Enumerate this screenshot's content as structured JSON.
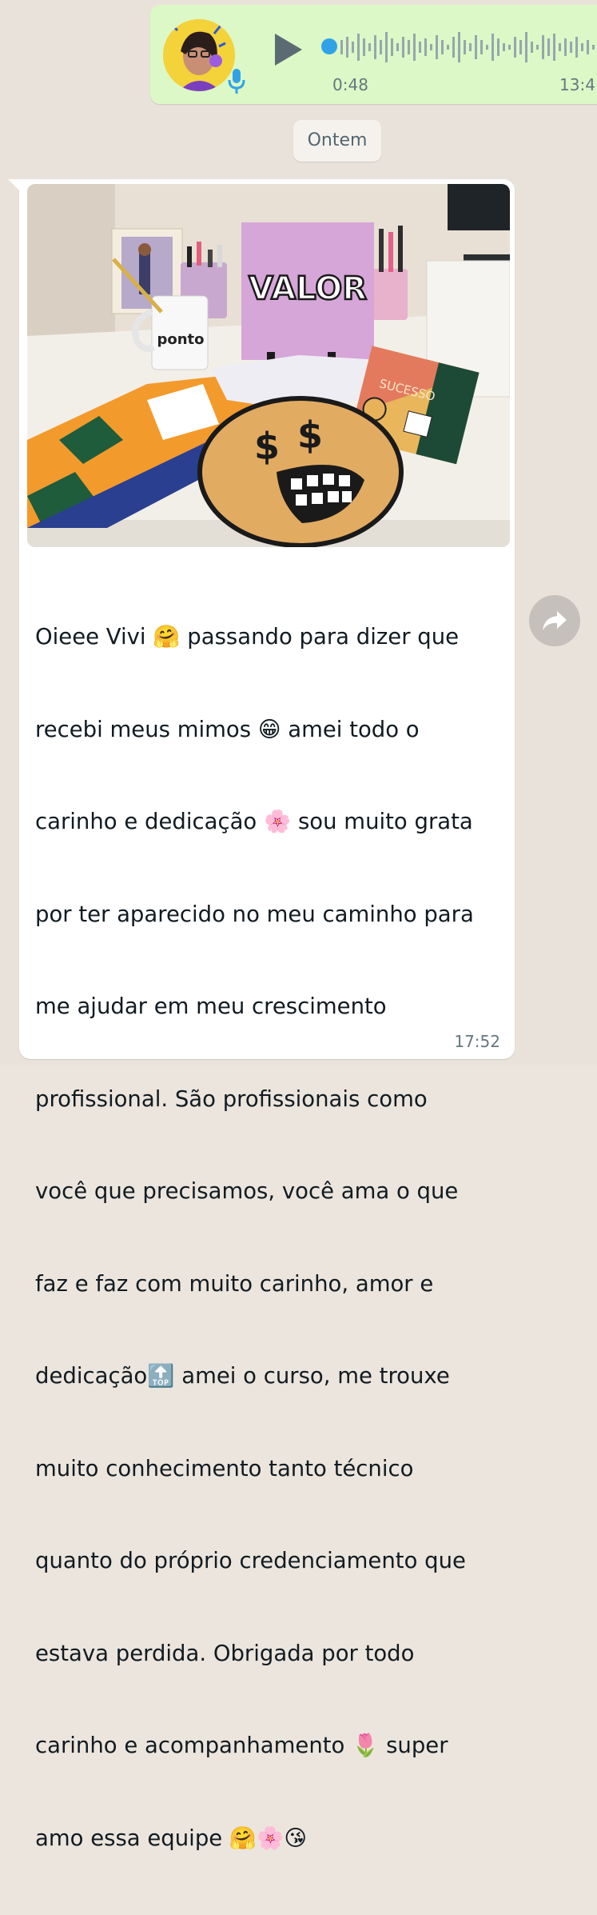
{
  "voice_note": {
    "duration": "0:48",
    "time": "13:4"
  },
  "date_separator": "Ontem",
  "message": {
    "photo_texts": {
      "poster": "VALOR",
      "mug": "ponto",
      "book": "SUCESSO"
    },
    "lines": [
      "Oieee Vivi 🤗 passando para dizer que",
      "recebi meus mimos 😁 amei todo o",
      "carinho e dedicação 🌸 sou muito grata",
      "por ter aparecido no meu caminho para",
      "me ajudar em meu crescimento",
      "profissional. São profissionais como",
      "você que precisamos, você ama o que",
      "faz e faz com muito carinho, amor e",
      "dedicação🔝 amei o curso, me trouxe",
      "muito conhecimento tanto técnico",
      "quanto do próprio credenciamento que",
      "estava perdida. Obrigada por todo",
      "carinho e acompanhamento 🌷 super",
      "amo essa equipe 🤗🌸😘"
    ],
    "time": "17:52"
  },
  "colors": {
    "outgoing_bubble": "#dcf8c6",
    "incoming_bubble": "#ffffff",
    "playback_dot": "#30a3e6",
    "mic": "#30a3e6"
  },
  "icons": {
    "play": "play-icon",
    "mic": "mic-icon",
    "forward": "forward-icon"
  }
}
